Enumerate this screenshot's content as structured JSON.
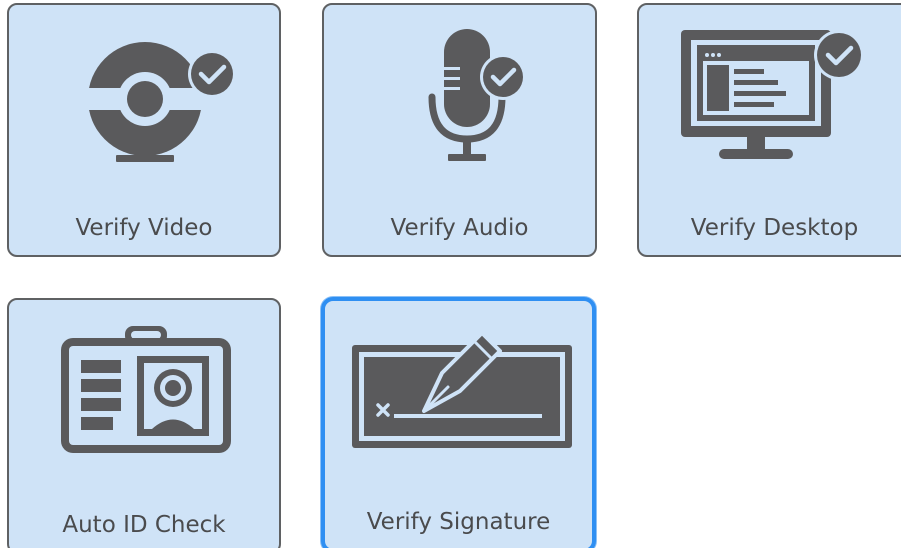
{
  "tiles": [
    {
      "label": "Verify Video",
      "icon": "webcam-check-icon",
      "selected": false
    },
    {
      "label": "Verify Audio",
      "icon": "microphone-check-icon",
      "selected": false
    },
    {
      "label": "Verify Desktop",
      "icon": "monitor-check-icon",
      "selected": false
    },
    {
      "label": "Auto ID Check",
      "icon": "id-badge-icon",
      "selected": false
    },
    {
      "label": "Verify Signature",
      "icon": "signature-pen-icon",
      "selected": true
    }
  ],
  "colors": {
    "tile_background": "#cfe3f7",
    "tile_border": "#5f6163",
    "icon": "#5a5a5c",
    "selected_border": "#2f8ff2",
    "label_text": "#4a4b4d"
  }
}
